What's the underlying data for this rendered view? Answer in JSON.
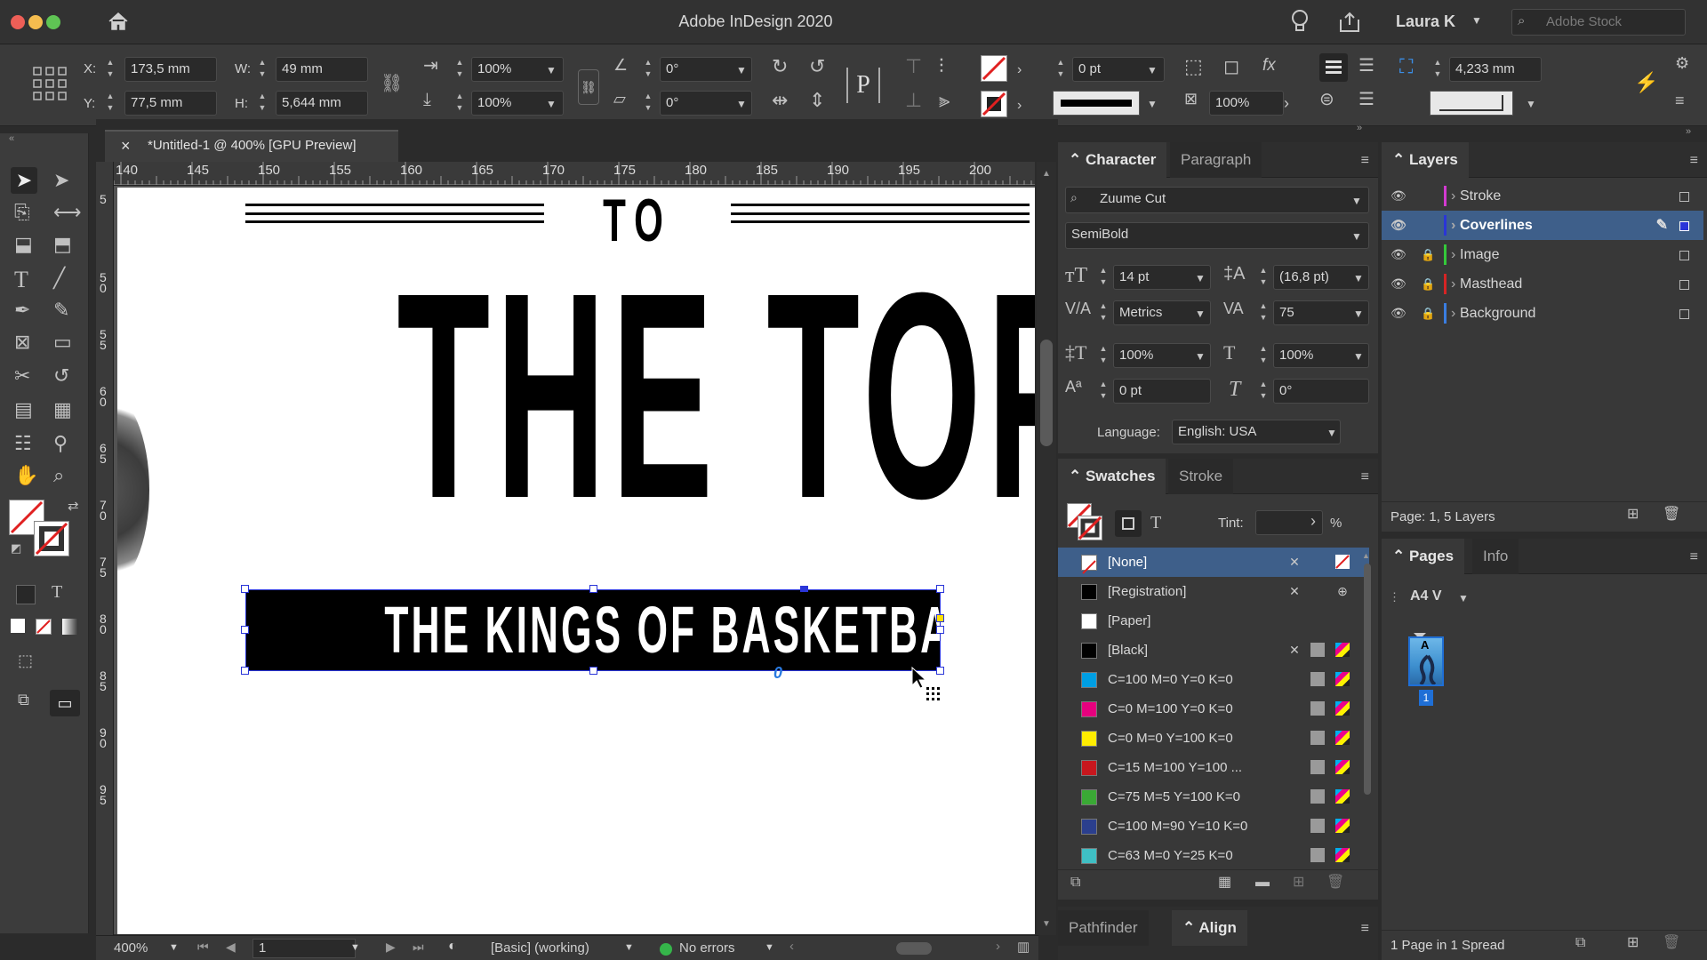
{
  "window": {
    "title": "Adobe InDesign 2020",
    "user": "Laura K",
    "stock_placeholder": "Adobe Stock"
  },
  "control": {
    "x_label": "X:",
    "x_value": "173,5 mm",
    "y_label": "Y:",
    "y_value": "77,5 mm",
    "w_label": "W:",
    "w_value": "49 mm",
    "h_label": "H:",
    "h_value": "5,644 mm",
    "scale_x": "100%",
    "scale_y": "100%",
    "rotate": "0°",
    "shear": "0°",
    "stroke_weight": "0 pt",
    "opacity": "100%",
    "offset": "4,233 mm"
  },
  "document_tab": {
    "close": "×",
    "title": "*Untitled-1 @ 400% [GPU Preview]"
  },
  "ruler": {
    "h_ticks": [
      "140",
      "145",
      "150",
      "155",
      "160",
      "165",
      "170",
      "175",
      "180",
      "185",
      "190",
      "195",
      "200"
    ],
    "v_ticks": [
      "5",
      "50",
      "55",
      "60",
      "65",
      "70",
      "75",
      "80",
      "85",
      "90",
      "95"
    ]
  },
  "artwork": {
    "to": "TO",
    "headline": "THE TOP",
    "banner": "THE KINGS OF BASKETBALL"
  },
  "status": {
    "zoom": "400%",
    "page": "1",
    "style": "[Basic] (working)",
    "errors": "No errors"
  },
  "character": {
    "tab_active": "Character",
    "tab_inactive": "Paragraph",
    "font_family": "Zuume Cut",
    "font_style": "SemiBold",
    "size": "14 pt",
    "leading": "(16,8 pt)",
    "kerning": "Metrics",
    "tracking": "75",
    "vscale": "100%",
    "hscale": "100%",
    "baseline": "0 pt",
    "skew": "0°",
    "language_label": "Language:",
    "language": "English: USA"
  },
  "swatches": {
    "tab_active": "Swatches",
    "tab_inactive": "Stroke",
    "tint_label": "Tint:",
    "tint_unit": "%",
    "items": [
      {
        "name": "[None]",
        "color": "#ffffff"
      },
      {
        "name": "[Registration]",
        "color": "#000000"
      },
      {
        "name": "[Paper]",
        "color": "#ffffff"
      },
      {
        "name": "[Black]",
        "color": "#000000"
      },
      {
        "name": "C=100 M=0 Y=0 K=0",
        "color": "#009fe3"
      },
      {
        "name": "C=0 M=100 Y=0 K=0",
        "color": "#e6007e"
      },
      {
        "name": "C=0 M=0 Y=100 K=0",
        "color": "#ffed00"
      },
      {
        "name": "C=15 M=100 Y=100 ...",
        "color": "#c8171e"
      },
      {
        "name": "C=75 M=5 Y=100 K=0",
        "color": "#3aa935"
      },
      {
        "name": "C=100 M=90 Y=10 K=0",
        "color": "#2b3f8e"
      },
      {
        "name": "C=63 M=0 Y=25 K=0",
        "color": "#3fbfc4"
      }
    ]
  },
  "bottom_tabs": {
    "inactive": "Pathfinder",
    "active": "Align"
  },
  "layers": {
    "title": "Layers",
    "items": [
      {
        "name": "Stroke",
        "color": "#d23ad0"
      },
      {
        "name": "Coverlines",
        "color": "#2a35d8"
      },
      {
        "name": "Image",
        "color": "#34c93a"
      },
      {
        "name": "Masthead",
        "color": "#d62424"
      },
      {
        "name": "Background",
        "color": "#3a7de0"
      }
    ],
    "footer": "Page: 1, 5 Layers"
  },
  "pages": {
    "tab_active": "Pages",
    "tab_inactive": "Info",
    "master": "A4 V",
    "thumb_letter": "A",
    "page_number": "1",
    "footer": "1 Page in 1 Spread"
  }
}
